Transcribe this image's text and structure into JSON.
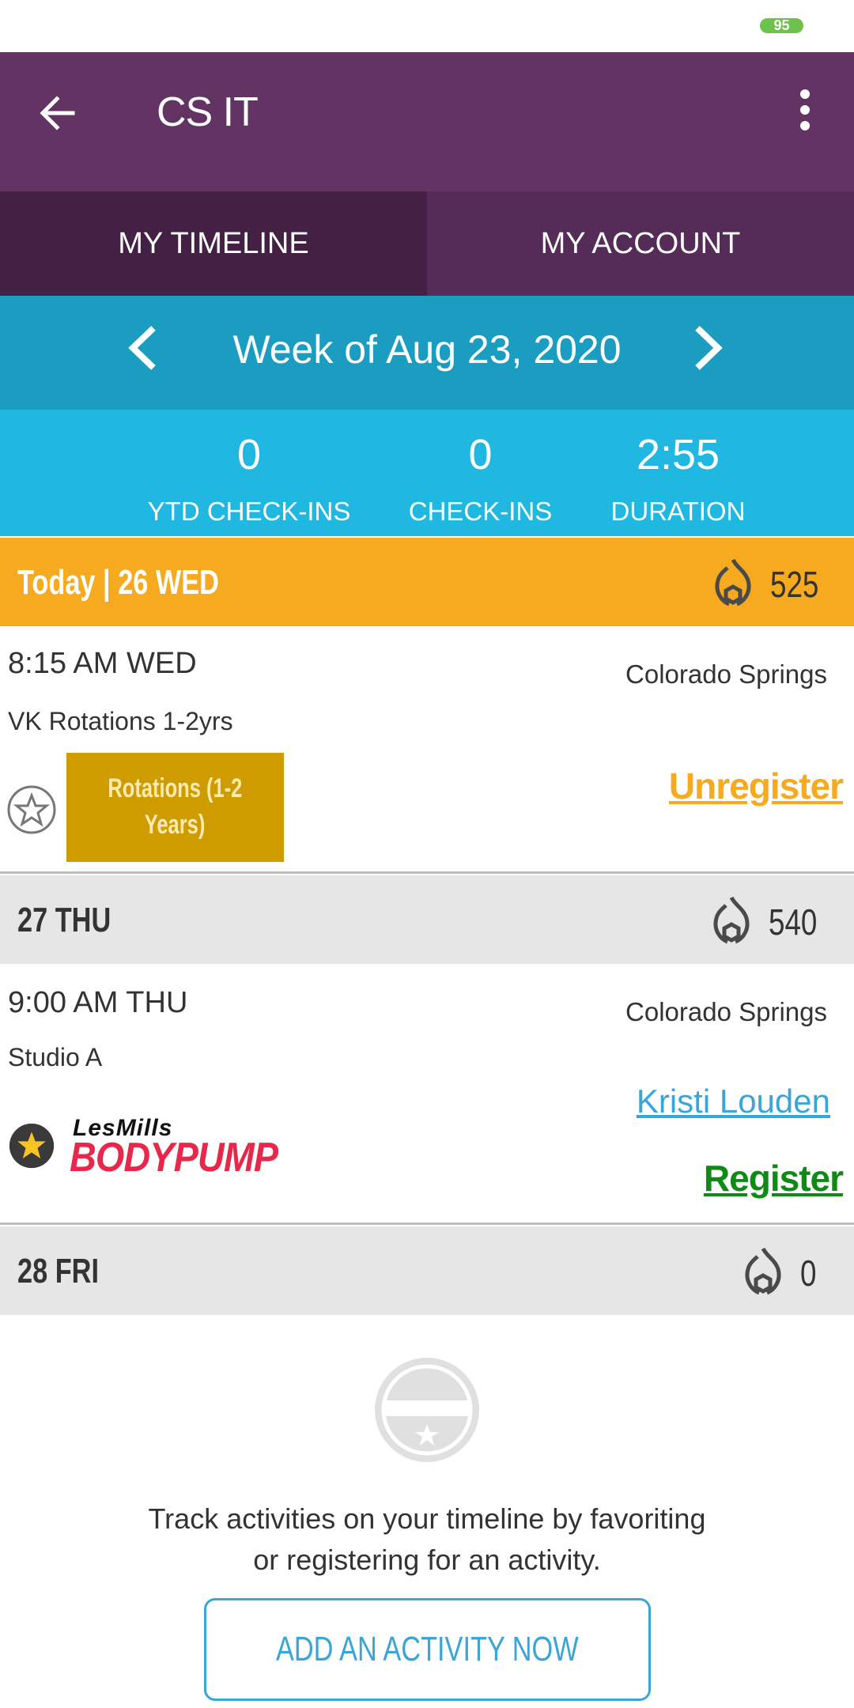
{
  "status_bar": {
    "battery_level": "95"
  },
  "app_bar": {
    "title": "CS IT",
    "back_icon": "arrow-left-icon",
    "menu_icon": "more-vertical-icon"
  },
  "tabs": [
    {
      "label": "MY TIMELINE",
      "active": true
    },
    {
      "label": "MY ACCOUNT",
      "active": false
    }
  ],
  "week": {
    "label": "Week of Aug 23, 2020",
    "prev_icon": "chevron-left-icon",
    "next_icon": "chevron-right-icon"
  },
  "stats": [
    {
      "value": "0",
      "label": "YTD CHECK-INS"
    },
    {
      "value": "0",
      "label": "CHECK-INS"
    },
    {
      "value": "2:55",
      "label": "DURATION"
    }
  ],
  "days": [
    {
      "label": "Today | 26 WED",
      "calories": "525",
      "activity": {
        "time": "8:15 AM WED",
        "location": "Colorado Springs",
        "room": "VK Rotations 1-2yrs",
        "thumb_line1": "Rotations (1-2",
        "thumb_line2": "Years)",
        "favorited": false,
        "action": "Unregister"
      }
    },
    {
      "label": "27 THU",
      "calories": "540",
      "activity": {
        "time": "9:00 AM THU",
        "location": "Colorado Springs",
        "room": "Studio A",
        "logo_top": "LesMills",
        "logo_bottom": "BODYPUMP",
        "favorited": true,
        "instructor": "Kristi Louden",
        "action": "Register"
      }
    },
    {
      "label": "28 FRI",
      "calories": "0"
    }
  ],
  "empty_state": {
    "line1": "Track activities on your timeline by favoriting",
    "line2": "or registering for an activity.",
    "button_label": "ADD AN ACTIVITY NOW"
  },
  "colors": {
    "app_bar": "#623363",
    "tab_active": "#432044",
    "tab_inactive": "#552b57",
    "week_bar": "#1a9dc0",
    "stats_bar": "#20b7e0",
    "today_header": "#f5aa1f",
    "unregister": "#f5aa1f",
    "register": "#0f8a14",
    "link_blue": "#3aa5d6"
  }
}
